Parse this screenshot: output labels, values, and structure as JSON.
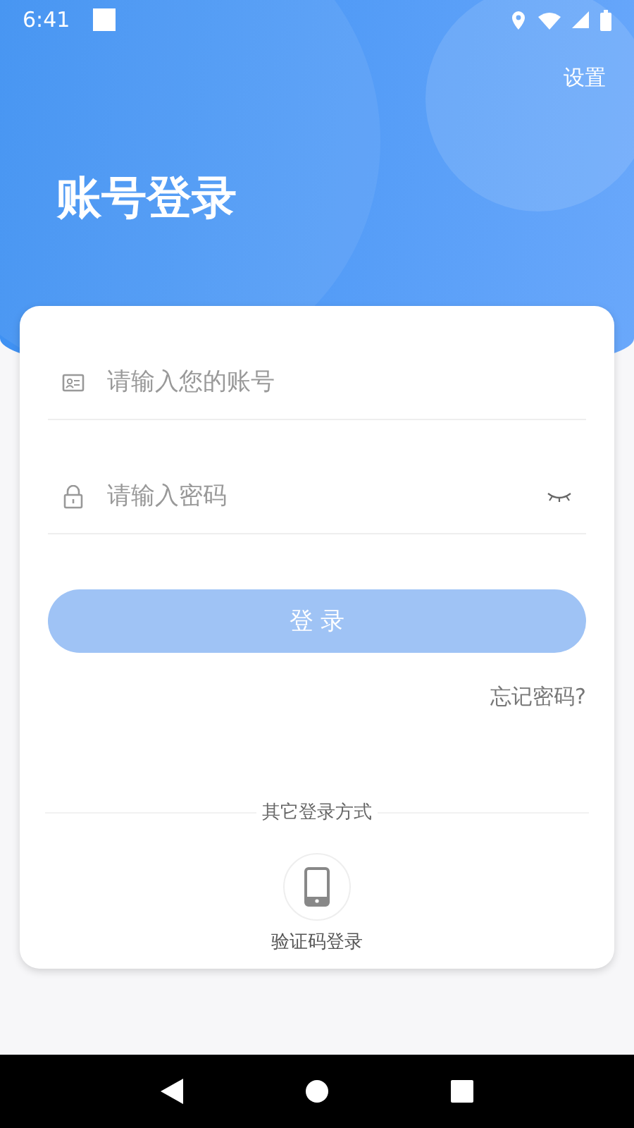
{
  "status_bar": {
    "time": "6:41"
  },
  "header": {
    "settings": "设置",
    "title": "账号登录"
  },
  "fields": [
    {
      "kind": "account",
      "placeholder": "请输入您的账号"
    },
    {
      "kind": "password",
      "placeholder": "请输入密码"
    }
  ],
  "login_button": {
    "label": "登 录",
    "disabled": true
  },
  "forgot_password": "忘记密码?",
  "other_login": {
    "label": "其它登录方式",
    "methods": [
      {
        "kind": "phone",
        "label": "验证码登录"
      }
    ]
  }
}
